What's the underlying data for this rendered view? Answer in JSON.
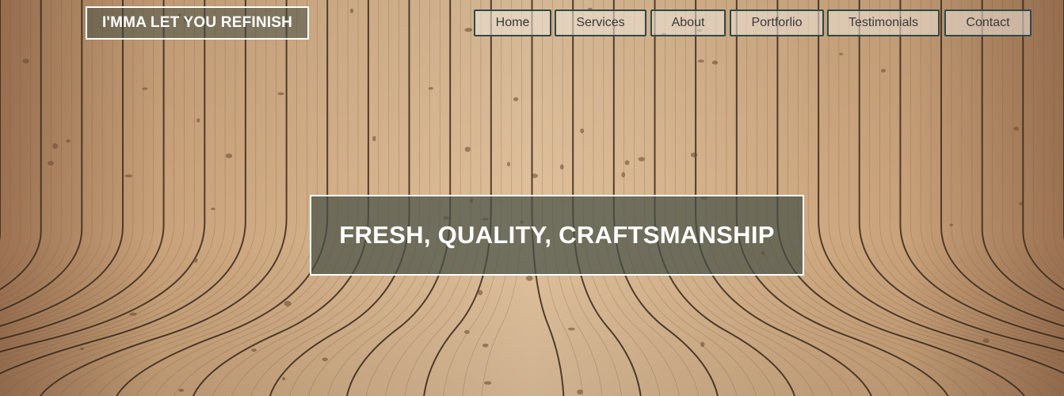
{
  "brand": {
    "logo_text": "I'MMA LET YOU REFINISH"
  },
  "nav": {
    "items": [
      {
        "label": "Home"
      },
      {
        "label": "Services"
      },
      {
        "label": "About"
      },
      {
        "label": "Portforlio"
      },
      {
        "label": "Testimonials"
      },
      {
        "label": "Contact"
      }
    ]
  },
  "hero": {
    "headline": "FRESH, QUALITY, CRAFTSMANSHIP",
    "background": "curved-wood-planks-image"
  },
  "colors": {
    "wood_light": "#e2c4a0",
    "wood_mid": "#c9a27a",
    "wood_dark": "#8a6446",
    "nav_border": "#2f4a47",
    "overlay": "#46503f",
    "text_light": "#ffffff",
    "text_dark": "#3a3a3a"
  }
}
